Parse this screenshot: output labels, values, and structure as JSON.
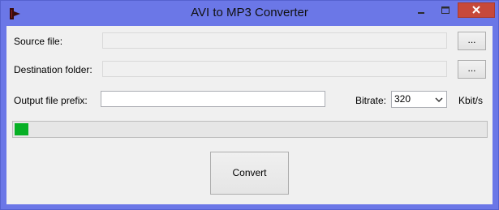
{
  "window": {
    "title": "AVI to MP3 Converter",
    "app_icon": "red-arrow-icon",
    "controls": [
      "minimize-icon",
      "maximize-icon",
      "close-icon"
    ],
    "colors": {
      "frame": "#6b77e7",
      "close": "#c7493a",
      "progress": "#06b025"
    }
  },
  "form": {
    "source_label": "Source file:",
    "source_value": "",
    "source_browse": "...",
    "dest_label": "Destination folder:",
    "dest_value": "",
    "dest_browse": "...",
    "prefix_label": "Output file prefix:",
    "prefix_value": "",
    "bitrate_label": "Bitrate:",
    "bitrate_value": "320",
    "bitrate_unit": "Kbit/s"
  },
  "progress": {
    "fraction": 0.03
  },
  "convert_label": "Convert"
}
